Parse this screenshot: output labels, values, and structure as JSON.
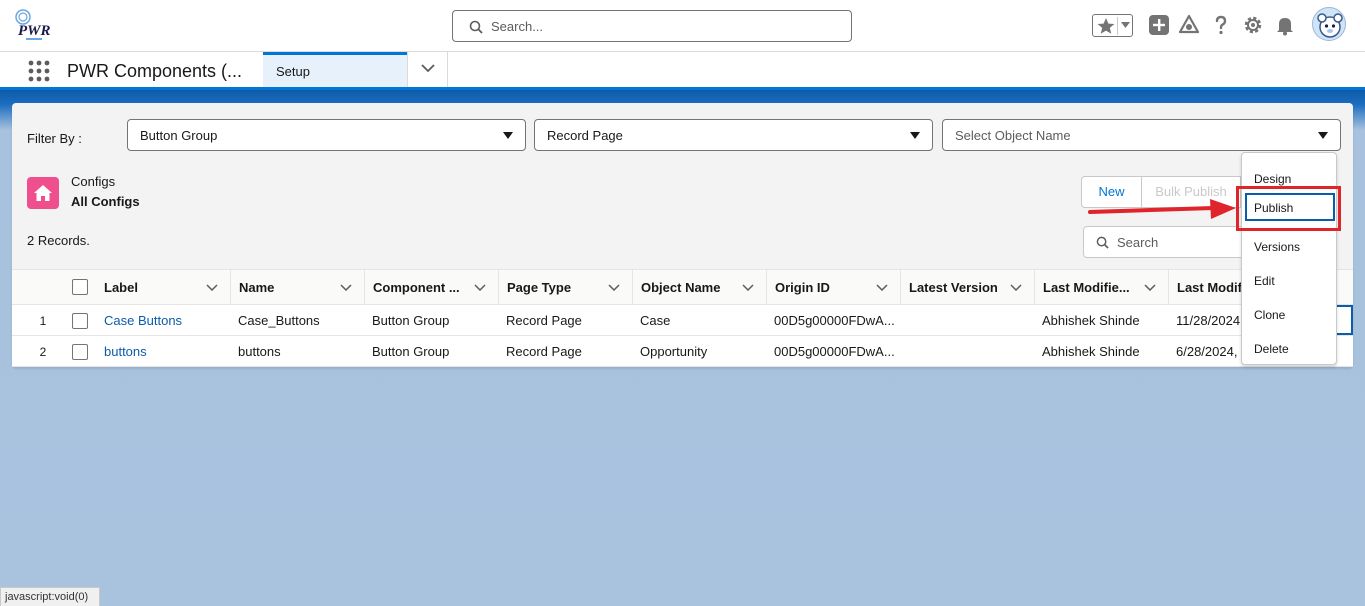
{
  "header": {
    "logo_text": "PWR",
    "search_placeholder": "Search..."
  },
  "icons": {
    "favorites": "star-icon",
    "add": "plus-icon",
    "trailhead": "trailhead-icon",
    "help": "question-icon",
    "setup": "gear-icon",
    "notifications": "bell-icon"
  },
  "app_nav": {
    "app_name": "PWR Components (...",
    "tab_label": "Setup"
  },
  "filters": {
    "label": "Filter By :",
    "component_type": "Button Group",
    "page_type": "Record Page",
    "object_placeholder": "Select Object Name"
  },
  "list": {
    "object": "Configs",
    "view": "All Configs",
    "record_count": "2 Records.",
    "new_label": "New",
    "bulk_publish_label": "Bulk Publish",
    "search_placeholder": "Search"
  },
  "table": {
    "columns": [
      "Label",
      "Name",
      "Component ...",
      "Page Type",
      "Object Name",
      "Origin ID",
      "Latest Version",
      "Last Modifie...",
      "Last Modif"
    ],
    "rows": [
      {
        "num": "1",
        "label": "Case Buttons",
        "name": "Case_Buttons",
        "component": "Button Group",
        "page_type": "Record Page",
        "object": "Case",
        "origin_id": "00D5g00000FDwA...",
        "latest_version": "",
        "last_modified_by": "Abhishek Shinde",
        "last_modified": "11/28/2024"
      },
      {
        "num": "2",
        "label": "buttons",
        "name": "buttons",
        "component": "Button Group",
        "page_type": "Record Page",
        "object": "Opportunity",
        "origin_id": "00D5g00000FDwA...",
        "latest_version": "",
        "last_modified_by": "Abhishek Shinde",
        "last_modified": "6/28/2024,"
      }
    ]
  },
  "row_menu": {
    "items": [
      "Design",
      "Publish",
      "Versions",
      "Edit",
      "Clone",
      "Delete"
    ],
    "focused": "Publish"
  },
  "status_bar": "javascript:void(0)",
  "colors": {
    "brand_blue": "#0176d3",
    "link": "#0b5cab",
    "highlight": "#e0242b",
    "object_icon": "#ef4f8c"
  }
}
